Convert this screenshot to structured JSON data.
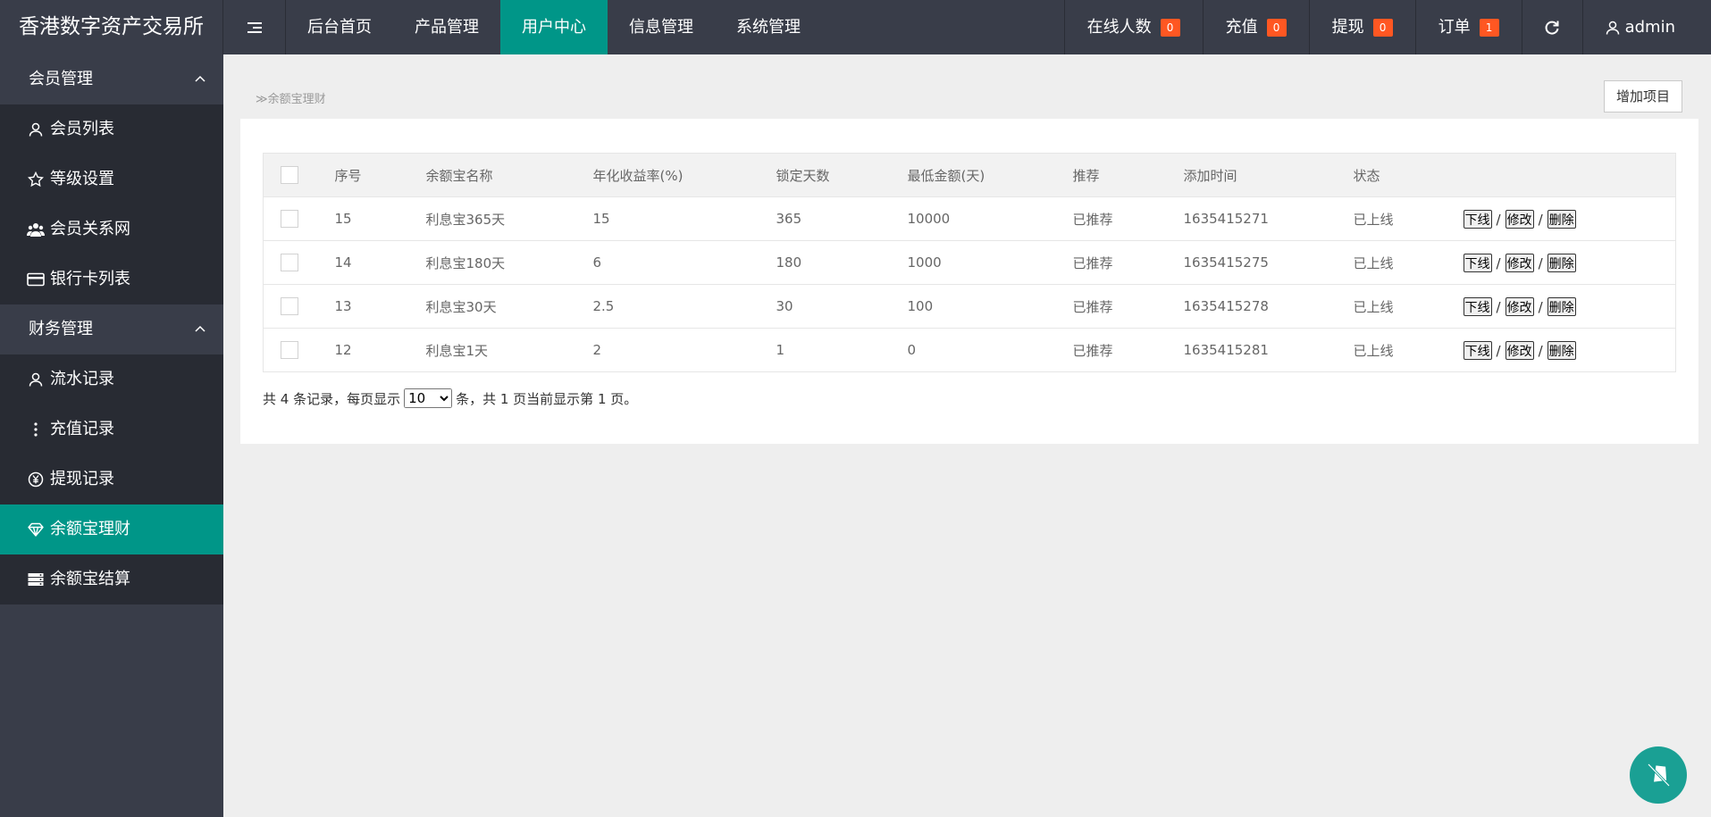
{
  "header": {
    "logo": "香港数字资产交易所",
    "nav": [
      "后台首页",
      "产品管理",
      "用户中心",
      "信息管理",
      "系统管理"
    ],
    "online_label": "在线人数",
    "online_count": "0",
    "recharge_label": "充值",
    "recharge_count": "0",
    "withdraw_label": "提现",
    "withdraw_count": "0",
    "order_label": "订单",
    "order_count": "1",
    "user": "admin"
  },
  "sidebar": {
    "group1": "会员管理",
    "member_list": "会员列表",
    "level": "等级设置",
    "relation": "会员关系网",
    "bankcard": "银行卡列表",
    "group2": "财务管理",
    "flow": "流水记录",
    "recharge": "充值记录",
    "withdraw": "提现记录",
    "yuebao": "余额宝理财",
    "settle": "余额宝结算"
  },
  "breadcrumb": "余额宝理财",
  "add_button": "增加项目",
  "table": {
    "headers": [
      "序号",
      "余额宝名称",
      "年化收益率(%)",
      "锁定天数",
      "最低金额(天)",
      "推荐",
      "添加时间",
      "状态"
    ],
    "rows": [
      {
        "id": "15",
        "name": "利息宝365天",
        "rate": "15",
        "days": "365",
        "min": "10000",
        "rec": "已推荐",
        "time": "1635415271",
        "status": "已上线"
      },
      {
        "id": "14",
        "name": "利息宝180天",
        "rate": "6",
        "days": "180",
        "min": "1000",
        "rec": "已推荐",
        "time": "1635415275",
        "status": "已上线"
      },
      {
        "id": "13",
        "name": "利息宝30天",
        "rate": "2.5",
        "days": "30",
        "min": "100",
        "rec": "已推荐",
        "time": "1635415278",
        "status": "已上线"
      },
      {
        "id": "12",
        "name": "利息宝1天",
        "rate": "2",
        "days": "1",
        "min": "0",
        "rec": "已推荐",
        "time": "1635415281",
        "status": "已上线"
      }
    ],
    "ops": {
      "offline": "下线",
      "edit": "修改",
      "delete": "删除",
      "sep": "/"
    }
  },
  "pager": {
    "prefix": "共 4 条记录，每页显示",
    "per_page": "10",
    "suffix": "条，共 1 页当前显示第 1 页。"
  }
}
